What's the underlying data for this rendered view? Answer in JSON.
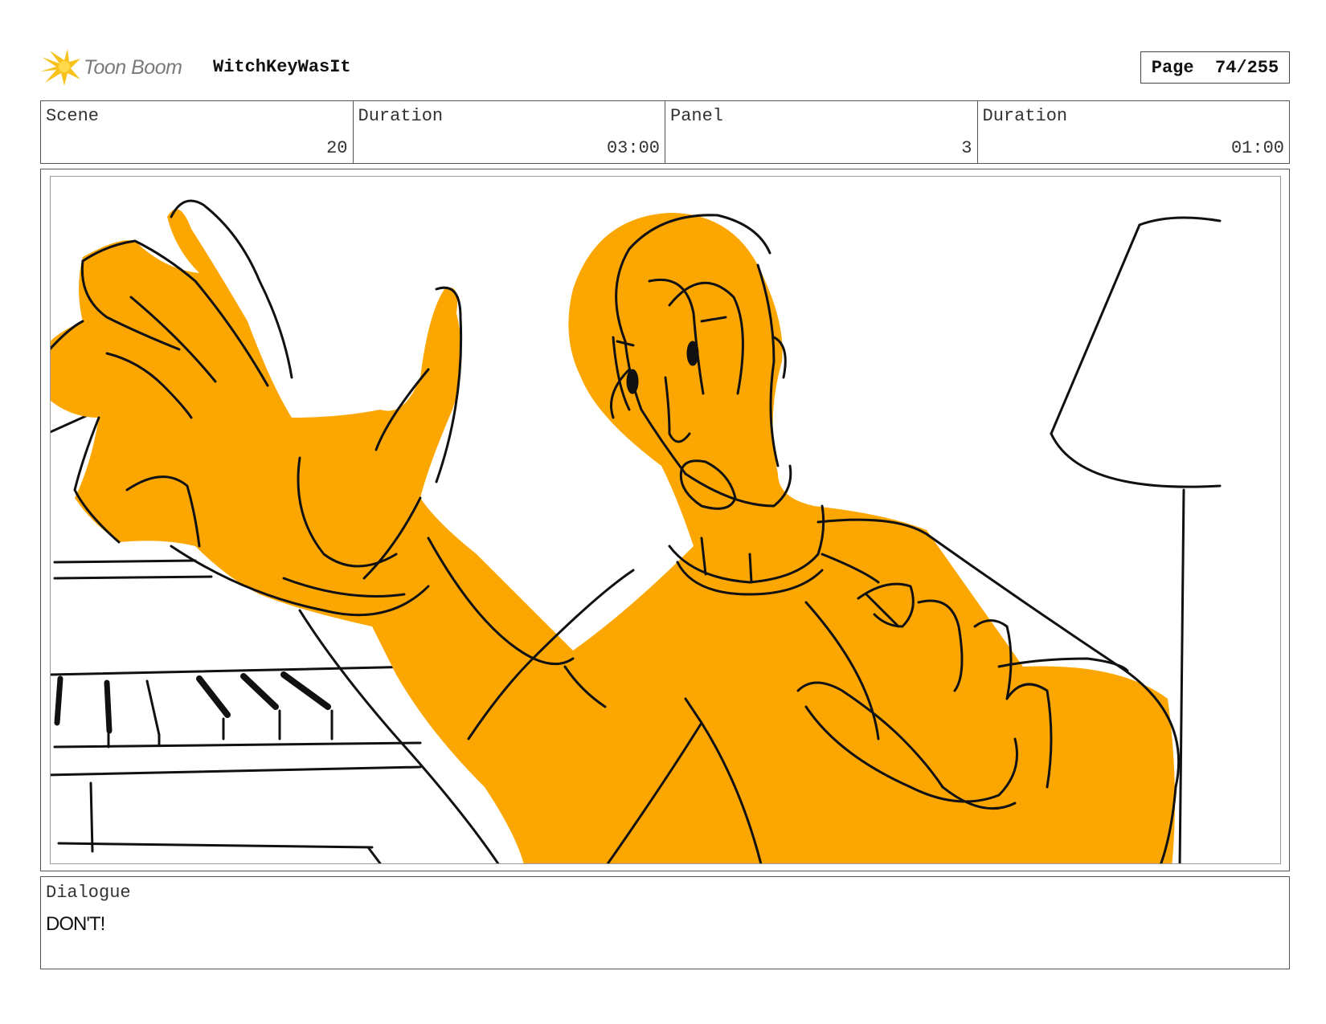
{
  "header": {
    "logo_text": "Toon Boom",
    "project_title": "WitchKeyWasIt",
    "page_label": "Page",
    "page_number": "74/255"
  },
  "info": {
    "scene_label": "Scene",
    "scene_value": "20",
    "scene_duration_label": "Duration",
    "scene_duration_value": "03:00",
    "panel_label": "Panel",
    "panel_value": "3",
    "panel_duration_label": "Duration",
    "panel_duration_value": "01:00"
  },
  "dialogue": {
    "label": "Dialogue",
    "text": "DON'T!"
  },
  "colors": {
    "fill": "#FCA701",
    "ink": "#111111",
    "logo_yellow": "#F7C21B"
  }
}
